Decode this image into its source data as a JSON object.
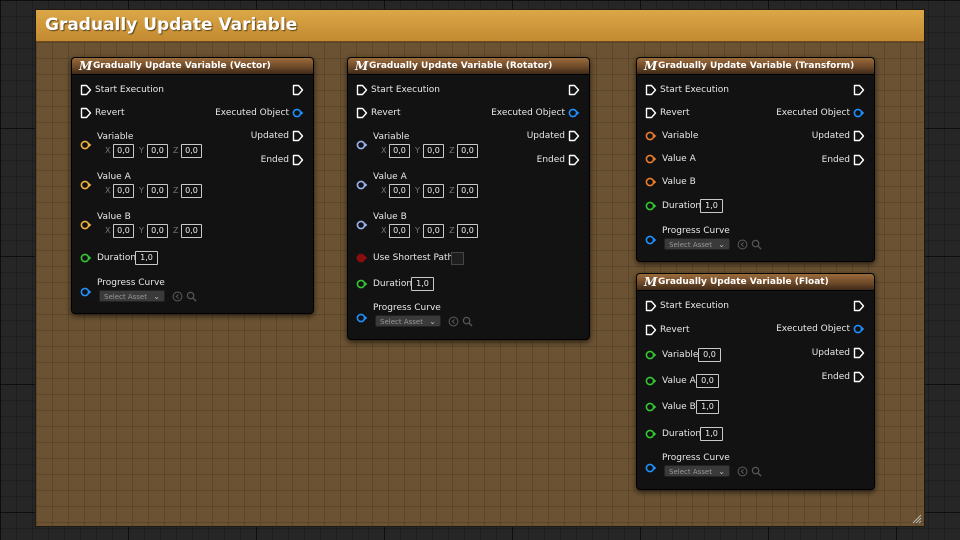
{
  "comment": {
    "title": "Gradually Update Variable"
  },
  "icon_glyph": "M",
  "colors": {
    "exec": "#ffffff",
    "object": "#1e90ff",
    "vector": "#f0b43c",
    "rotator": "#9db3f5",
    "transform": "#ec7d2c",
    "float": "#34c734",
    "bool": "#8b0e0e"
  },
  "common": {
    "start_execution": "Start Execution",
    "revert": "Revert",
    "executed_object": "Executed Object",
    "updated": "Updated",
    "ended": "Ended",
    "variable": "Variable",
    "value_a": "Value A",
    "value_b": "Value B",
    "duration": "Duration",
    "progress_curve": "Progress Curve",
    "select_asset": "Select Asset",
    "use_shortest_path": "Use Shortest Path",
    "axis_x": "X",
    "axis_y": "Y",
    "axis_z": "Z",
    "zero": "0,0",
    "one": "1,0",
    "chevron": "⌄"
  },
  "nodes": {
    "vector": {
      "title": "Gradually Update Variable (Vector)"
    },
    "rotator": {
      "title": "Gradually Update Variable (Rotator)"
    },
    "transform": {
      "title": "Gradually Update Variable (Transform)"
    },
    "float": {
      "title": "Gradually Update Variable (Float)"
    }
  }
}
